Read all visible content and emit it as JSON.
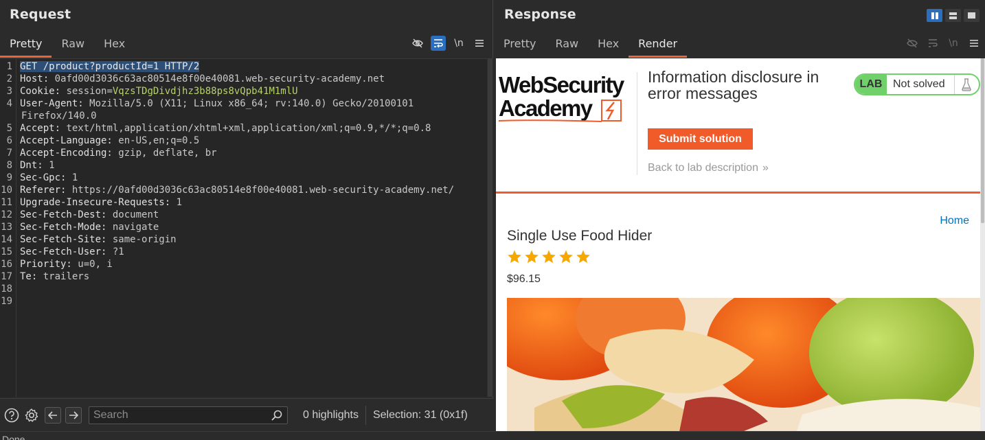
{
  "request": {
    "title": "Request",
    "tabs": [
      "Pretty",
      "Raw",
      "Hex"
    ],
    "active_tab": "Pretty",
    "lines": [
      {
        "n": "1",
        "key": "",
        "val": "",
        "full": "GET /product?productId=1 HTTP/2"
      },
      {
        "n": "2",
        "key": "Host:",
        "val": " 0afd00d3036c63ac80514e8f00e40081.web-security-academy.net"
      },
      {
        "n": "3",
        "key": "Cookie:",
        "val": " session=",
        "cookie": "VqzsTDgDivdjhz3b88ps8vQpb41M1mlU"
      },
      {
        "n": "4",
        "key": "User-Agent:",
        "val": " Mozilla/5.0 (X11; Linux x86_64; rv:140.0) Gecko/20100101",
        "wrap": "Firefox/140.0"
      },
      {
        "n": "5",
        "key": "Accept:",
        "val": " text/html,application/xhtml+xml,application/xml;q=0.9,*/*;q=0.8"
      },
      {
        "n": "6",
        "key": "Accept-Language:",
        "val": " en-US,en;q=0.5"
      },
      {
        "n": "7",
        "key": "Accept-Encoding:",
        "val": " gzip, deflate, br"
      },
      {
        "n": "8",
        "key": "Dnt:",
        "val": " 1"
      },
      {
        "n": "9",
        "key": "Sec-Gpc:",
        "val": " 1"
      },
      {
        "n": "10",
        "key": "Referer:",
        "val": " https://0afd00d3036c63ac80514e8f00e40081.web-security-academy.net/"
      },
      {
        "n": "11",
        "key": "Upgrade-Insecure-Requests:",
        "val": " 1"
      },
      {
        "n": "12",
        "key": "Sec-Fetch-Dest:",
        "val": " document"
      },
      {
        "n": "13",
        "key": "Sec-Fetch-Mode:",
        "val": " navigate"
      },
      {
        "n": "14",
        "key": "Sec-Fetch-Site:",
        "val": " same-origin"
      },
      {
        "n": "15",
        "key": "Sec-Fetch-User:",
        "val": " ?1"
      },
      {
        "n": "16",
        "key": "Priority:",
        "val": " u=0, i"
      },
      {
        "n": "17",
        "key": "Te:",
        "val": " trailers"
      },
      {
        "n": "18",
        "key": "",
        "val": ""
      },
      {
        "n": "19",
        "key": "",
        "val": ""
      }
    ],
    "toolbar_newline": "\\n",
    "search_placeholder": "Search",
    "highlights": "0 highlights",
    "selection": "Selection: 31 (0x1f)"
  },
  "response": {
    "title": "Response",
    "tabs": [
      "Pretty",
      "Raw",
      "Hex",
      "Render"
    ],
    "active_tab": "Render",
    "toolbar_newline": "\\n",
    "render": {
      "logo_line1": "WebSecurity",
      "logo_line2": "Academy",
      "lab_title": "Information disclosure in error messages",
      "lab_badge": "LAB",
      "lab_status": "Not solved",
      "submit_label": "Submit solution",
      "back_label": "Back to lab description",
      "home_link": "Home",
      "product_name": "Single Use Food Hider",
      "rating": 5,
      "price": "$96.15"
    }
  },
  "status_bar": {
    "text": "Done"
  },
  "colors": {
    "accent": "#e8663a",
    "blue": "#2a6ebd",
    "portswigger_orange": "#f15a29",
    "lab_green": "#70d16b",
    "cookie_value": "#b8d26a"
  }
}
